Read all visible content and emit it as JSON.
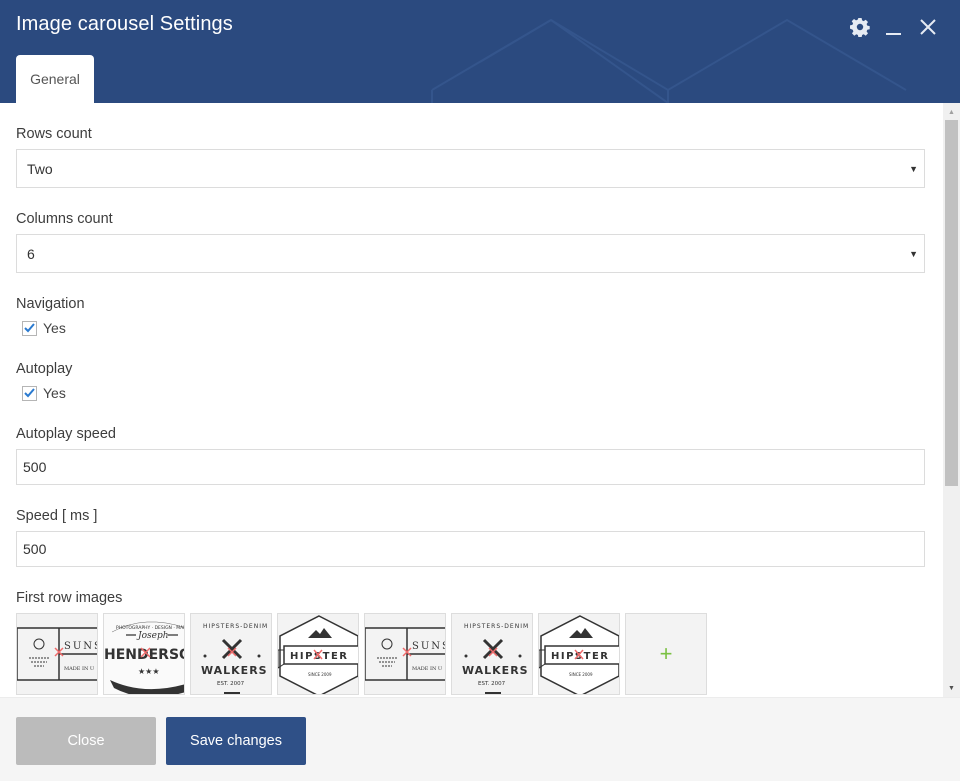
{
  "window": {
    "title": "Image carousel Settings",
    "icons": [
      "gear-icon",
      "minimize-icon",
      "close-icon"
    ]
  },
  "tabs": [
    {
      "label": "General",
      "active": true
    }
  ],
  "form": {
    "rows_count": {
      "label": "Rows count",
      "value": "Two"
    },
    "columns_count": {
      "label": "Columns count",
      "value": "6"
    },
    "navigation": {
      "label": "Navigation",
      "option": "Yes",
      "checked": true
    },
    "autoplay": {
      "label": "Autoplay",
      "option": "Yes",
      "checked": true
    },
    "autoplay_speed": {
      "label": "Autoplay speed",
      "value": "500"
    },
    "speed": {
      "label": "Speed [ ms ]",
      "value": "500"
    },
    "first_row_images": {
      "label": "First row images",
      "images": [
        {
          "name": "sunset-logo",
          "text": "SUNS",
          "subtext": "MADE IN U"
        },
        {
          "name": "joseph-henderson-logo",
          "text": "HENDERSO",
          "subtext": "Joseph"
        },
        {
          "name": "hipsters-denim-walkers-logo",
          "text": "WALKERS",
          "subtext": "EST. 2007"
        },
        {
          "name": "hipster-logo",
          "text": "HIPSTER",
          "subtext": "SINCE 2009"
        },
        {
          "name": "sunset-logo",
          "text": "SUNS",
          "subtext": "MADE IN U"
        },
        {
          "name": "hipsters-denim-walkers-logo",
          "text": "WALKERS",
          "subtext": "EST. 2007"
        },
        {
          "name": "hipster-logo",
          "text": "HIPSTER",
          "subtext": "SINCE 2009"
        }
      ],
      "add_label": "+"
    }
  },
  "footer": {
    "close_label": "Close",
    "save_label": "Save changes"
  },
  "colors": {
    "header": "#2b4a7f",
    "primary_button": "#2f5087",
    "secondary_button": "#bbbbbb",
    "add_icon": "#7ac142",
    "remove_icon": "#f06b6b"
  }
}
